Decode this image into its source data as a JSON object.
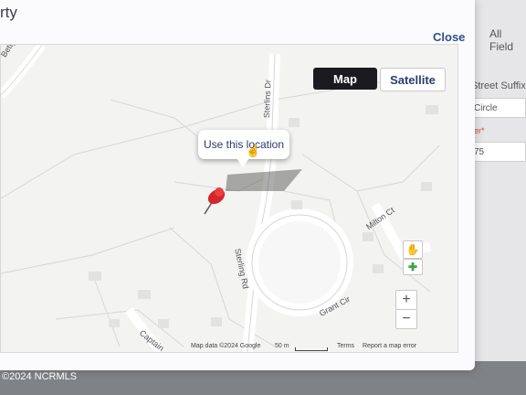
{
  "modal": {
    "title_partial": "rty",
    "close_label": "Close"
  },
  "map": {
    "type_buttons": {
      "map": "Map",
      "satellite": "Satellite"
    },
    "selected_type": "Map",
    "tooltip": "Use this location",
    "streets": {
      "betty": "Betty Dix",
      "sterlins_dr": "Sterlins Dr",
      "sterling_rd": "Sterling Rd",
      "milton_ct": "Milton Ct",
      "grant_cir": "Grant Cir",
      "captain": "Captain"
    },
    "controls": {
      "zoom_in": "+",
      "zoom_out": "−"
    },
    "attribution": {
      "data": "Map data ©2024 Google",
      "scale": "50 m",
      "terms": "Terms",
      "report": "Report a map error"
    }
  },
  "right_panel": {
    "tab_partial": "All Field",
    "street_suffix_label": "Street Suffix",
    "street_suffix_value": "Circle",
    "identifier_partial": "entifier*",
    "number_partial": "75"
  },
  "watermark": "©2024 NCRMLS",
  "colors": {
    "map_button_bg": "#1b1b1f",
    "link_blue": "#2f4f8a",
    "pin_red": "#d3262b"
  }
}
